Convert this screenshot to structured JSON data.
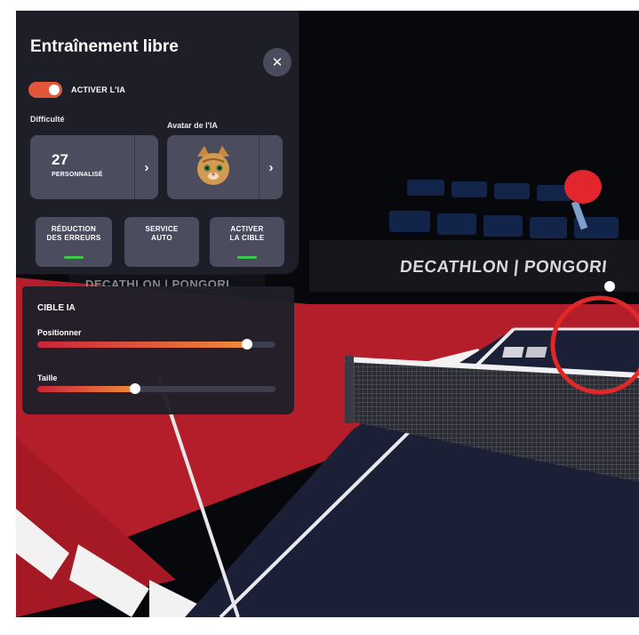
{
  "panel": {
    "title": "Entraînement libre",
    "close_icon": "close-icon",
    "toggle_label": "ACTIVER L'IA",
    "toggle_on": true,
    "difficulty_label": "Difficulté",
    "avatar_label": "Avatar de l'IA",
    "difficulty_value": "27",
    "difficulty_caption": "PERSONNALISÉ",
    "chevron_icon": "chevron-right-icon",
    "avatar_icon": "cat-avatar-icon",
    "options": [
      {
        "label_line1": "RÉDUCTION",
        "label_line2": "DES ERREURS",
        "active": true
      },
      {
        "label_line1": "SERVICE",
        "label_line2": "AUTO",
        "active": false
      },
      {
        "label_line1": "ACTIVER",
        "label_line2": "LA CIBLE",
        "active": true
      }
    ]
  },
  "target_panel": {
    "title": "CIBLE IA",
    "sliders": [
      {
        "label": "Positionner",
        "value": 0.88
      },
      {
        "label": "Taille",
        "value": 0.41
      }
    ]
  },
  "scene": {
    "banner_main": "DECATHLON | PONGORI",
    "banner_small": "DECATHLON | PONGORI",
    "paddle_icon": "paddle-icon",
    "ball_icon": "ball-icon",
    "target_marker": "target-circle-icon"
  },
  "colors": {
    "accent": "#e2573a",
    "panel_bg": "#1e1f2a",
    "button_bg": "#4b4c5e",
    "indicator_green": "#3ec94a",
    "floor_red": "#b41e2a",
    "table_blue": "#1e2237",
    "target_circle": "#e02828"
  }
}
